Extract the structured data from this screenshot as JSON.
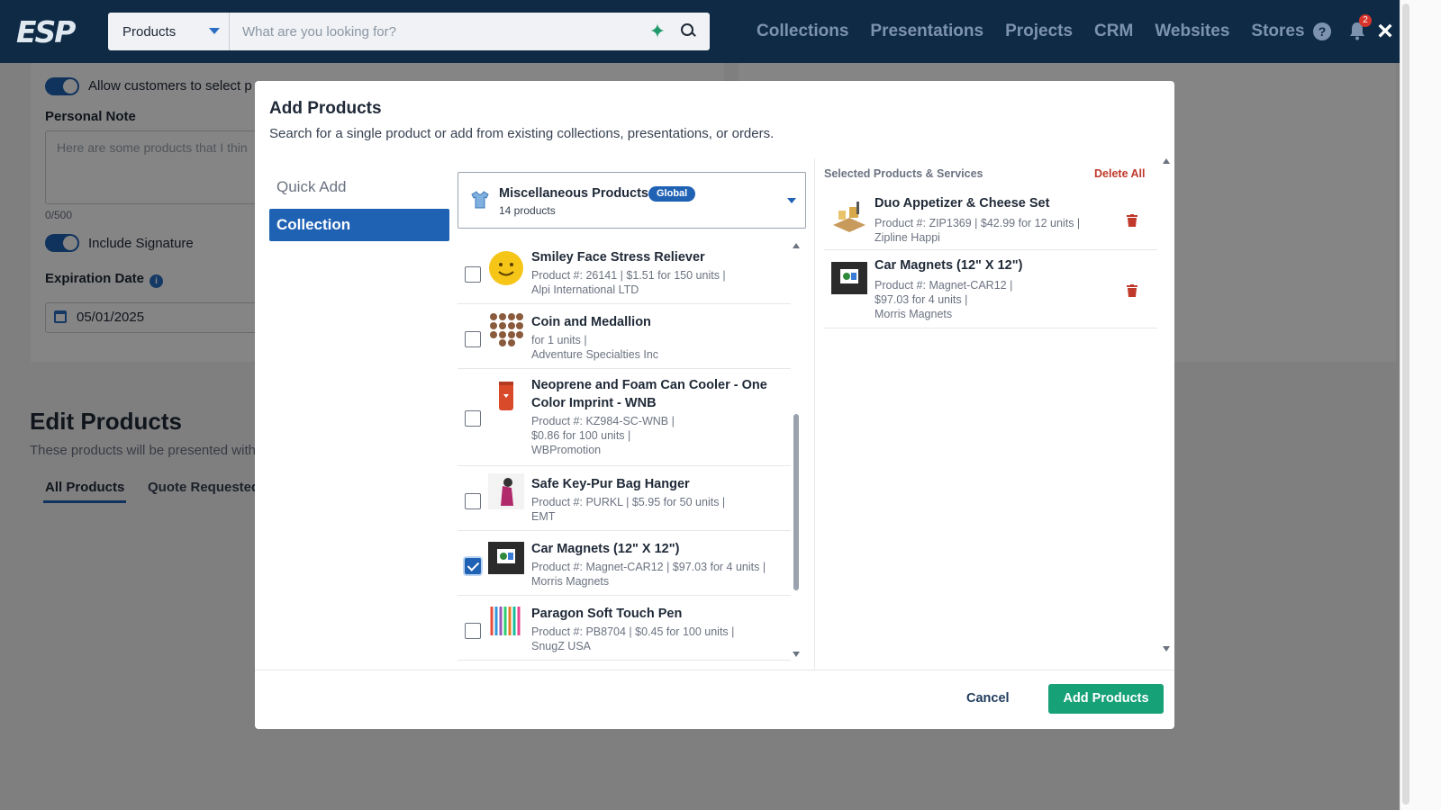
{
  "topbar": {
    "logo": "ESP",
    "search": {
      "scope": "Products",
      "placeholder": "What are you looking for?"
    },
    "nav": [
      "Collections",
      "Presentations",
      "Projects",
      "CRM",
      "Websites",
      "Stores"
    ],
    "help_icon": "?",
    "notifications_count": "2",
    "close_icon": "×"
  },
  "background": {
    "allow_label": "Allow customers to select p",
    "personal_note_label": "Personal Note",
    "note_placeholder": "Here are some products that I thin",
    "note_counter": "0/500",
    "include_signature": "Include Signature",
    "expiration_label": "Expiration Date",
    "expiration_value": "05/01/2025",
    "edit_title": "Edit Products",
    "edit_sub": "These products will be presented with",
    "tabs": [
      "All Products",
      "Quote Requested"
    ]
  },
  "modal": {
    "title": "Add Products",
    "subtitle": "Search for a single product or add from existing collections, presentations, or orders.",
    "tabs": [
      {
        "label": "Quick Add",
        "active": false
      },
      {
        "label": "Collection",
        "active": true
      }
    ],
    "collection": {
      "name": "Miscellaneous Products",
      "badge": "Global",
      "count": "14 products"
    },
    "products": [
      {
        "name": "Smiley Face Stress Reliever",
        "meta1": "Product #: 26141  |  $1.51 for 150 units  |",
        "meta2": "Alpi International LTD",
        "checked": false
      },
      {
        "name": "Coin and Medallion",
        "meta1": "for 1 units  |",
        "meta2": "Adventure Specialties Inc",
        "checked": false
      },
      {
        "name": "Neoprene and Foam Can Cooler - One Color Imprint - WNB",
        "meta1": "Product #: KZ984-SC-WNB  |",
        "meta1b": "$0.86 for 100 units  |",
        "meta2": "WBPromotion",
        "checked": false
      },
      {
        "name": "Safe Key-Pur Bag Hanger",
        "meta1": "Product #: PURKL  |  $5.95 for 50 units  |",
        "meta2": "EMT",
        "checked": false
      },
      {
        "name": "Car Magnets (12\" X 12\")",
        "meta1": "Product #: Magnet-CAR12  |  $97.03 for 4 units  |",
        "meta2": "Morris Magnets",
        "checked": true
      },
      {
        "name": "Paragon Soft Touch Pen",
        "meta1": "Product #: PB8704  |  $0.45 for 100 units  |",
        "meta2": "SnugZ USA",
        "checked": false
      }
    ],
    "selected": {
      "title": "Selected Products & Services",
      "delete_all": "Delete All",
      "items": [
        {
          "name": "Duo Appetizer & Cheese Set",
          "meta1": "Product #: ZIP1369  |  $42.99 for 12 units  |",
          "meta2": "Zipline Happi"
        },
        {
          "name": "Car Magnets (12\" X 12\")",
          "meta1": "Product #: Magnet-CAR12  |",
          "meta1b": "$97.03 for 4 units  |",
          "meta2": "Morris Magnets"
        }
      ]
    },
    "cancel": "Cancel",
    "add": "Add Products"
  },
  "colors": {
    "navy": "#0e2a45",
    "primary": "#1f62b4",
    "success": "#17a177",
    "danger": "#c0392b"
  }
}
